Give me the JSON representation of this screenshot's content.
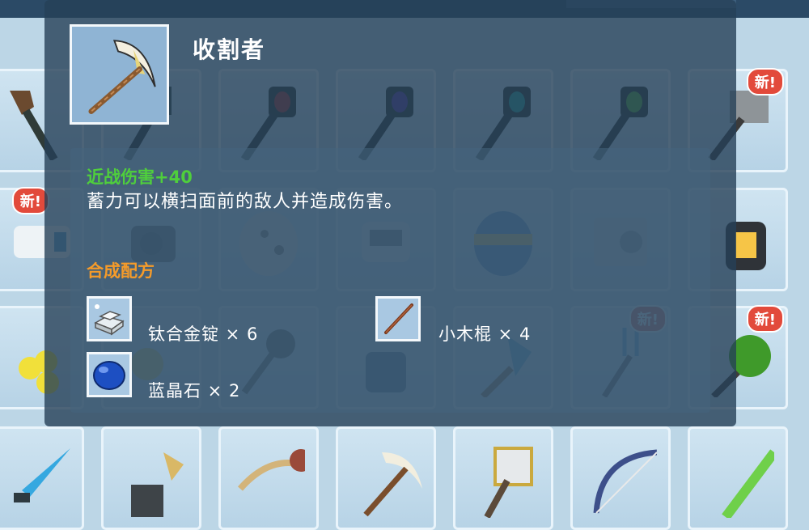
{
  "item": {
    "name": "收割者",
    "icon": "scythe-pickaxe-icon"
  },
  "stats": {
    "bonus": "近战伤害+40",
    "description": "蓄力可以横扫面前的敌人并造成伤害。"
  },
  "recipe": {
    "title": "合成配方",
    "ingredients": [
      {
        "label": "钛合金锭 × 6",
        "icon": "titanium-ingot-icon"
      },
      {
        "label": "小木棍 × 4",
        "icon": "wooden-stick-icon"
      },
      {
        "label": "蓝晶石 × 2",
        "icon": "blue-crystal-icon"
      }
    ]
  },
  "badges": {
    "new": "新!"
  },
  "colors": {
    "bonus_text": "#4fcf3c",
    "recipe_title": "#f59b2a",
    "badge": "#e24a3b",
    "overlay": "#264058"
  }
}
